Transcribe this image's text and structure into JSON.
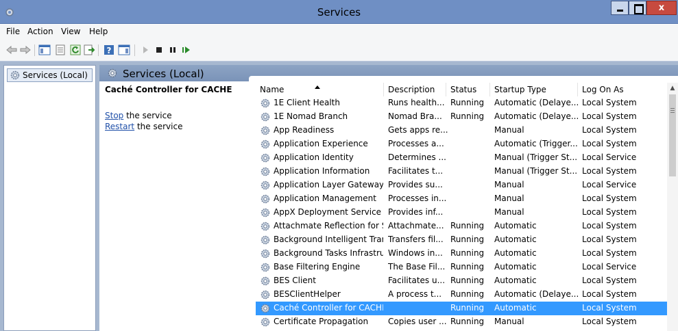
{
  "window": {
    "title": "Services",
    "close_glyph": "x"
  },
  "menu": [
    "File",
    "Action",
    "View",
    "Help"
  ],
  "toolbar": [
    "back-arrow-icon",
    "forward-arrow-icon",
    "show-hide-console-tree-icon",
    "properties-icon",
    "refresh-icon",
    "export-list-icon",
    "help-icon",
    "show-hide-action-pane-icon",
    "start-service-icon",
    "stop-service-icon",
    "pause-service-icon",
    "resume-service-icon"
  ],
  "tree": {
    "root_label": "Services (Local)"
  },
  "pane": {
    "header": "Services (Local)",
    "selected_title": "Caché Controller for CACHE",
    "stop_link": "Stop",
    "stop_rest": " the service",
    "restart_link": "Restart",
    "restart_rest": " the service"
  },
  "columns": [
    "Name",
    "Description",
    "Status",
    "Startup Type",
    "Log On As"
  ],
  "services": [
    [
      "1E Client Health",
      "Runs health...",
      "Running",
      "Automatic (Delaye...",
      "Local System"
    ],
    [
      "1E Nomad Branch",
      "Nomad Bra...",
      "Running",
      "Automatic (Delaye...",
      "Local System"
    ],
    [
      "App Readiness",
      "Gets apps re...",
      "",
      "Manual",
      "Local System"
    ],
    [
      "Application Experience",
      "Processes a...",
      "",
      "Automatic (Trigger...",
      "Local System"
    ],
    [
      "Application Identity",
      "Determines ...",
      "",
      "Manual (Trigger St...",
      "Local Service"
    ],
    [
      "Application Information",
      "Facilitates t...",
      "",
      "Manual (Trigger St...",
      "Local System"
    ],
    [
      "Application Layer Gateway ...",
      "Provides su...",
      "",
      "Manual",
      "Local Service"
    ],
    [
      "Application Management",
      "Processes in...",
      "",
      "Manual",
      "Local System"
    ],
    [
      "AppX Deployment Service (...",
      "Provides inf...",
      "",
      "Manual",
      "Local System"
    ],
    [
      "Attachmate Reflection for S...",
      "Attachmate...",
      "Running",
      "Automatic",
      "Local System"
    ],
    [
      "Background Intelligent Tran...",
      "Transfers fil...",
      "Running",
      "Automatic",
      "Local System"
    ],
    [
      "Background Tasks Infrastru...",
      "Windows in...",
      "Running",
      "Automatic",
      "Local System"
    ],
    [
      "Base Filtering Engine",
      "The Base Fil...",
      "Running",
      "Automatic",
      "Local Service"
    ],
    [
      "BES Client",
      "Facilitates u...",
      "Running",
      "Automatic",
      "Local System"
    ],
    [
      "BESClientHelper",
      "A process t...",
      "Running",
      "Automatic (Delaye...",
      "Local System"
    ],
    [
      "Caché Controller for CACHE",
      "",
      "Running",
      "Automatic",
      "Local System"
    ],
    [
      "Certificate Propagation",
      "Copies user ...",
      "Running",
      "Manual",
      "Local System"
    ]
  ],
  "selected_index": 15,
  "colors": {
    "titlebar": "#6f8fc4",
    "selection": "#3399ff",
    "pane_header": "#8da4c4",
    "close_button": "#c74a3f"
  }
}
